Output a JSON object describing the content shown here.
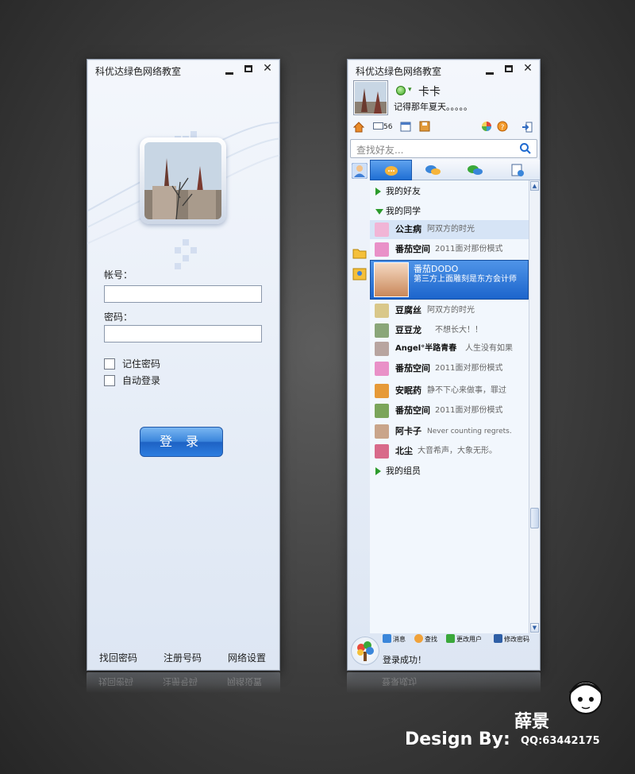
{
  "login_window": {
    "title": "科优达绿色网络教室",
    "account_label": "帐号：",
    "password_label": "密码：",
    "account_value": "",
    "password_value": "",
    "remember_label": "记住密码",
    "autologin_label": "自动登录",
    "login_button": "登 录",
    "footer": {
      "recover": "找回密码",
      "register": "注册号码",
      "network": "网络设置"
    }
  },
  "main_window": {
    "title": "科优达绿色网络教室",
    "nickname": "卡卡",
    "signature": "记得那年夏天。。。。。",
    "mail_count": "56",
    "search_placeholder": "查找好友...",
    "groups": [
      {
        "label": "我的好友",
        "expanded": false
      },
      {
        "label": "我的同学",
        "expanded": true
      },
      {
        "label": "我的组员",
        "expanded": false
      }
    ],
    "contacts": [
      {
        "name": "公主病",
        "status": "阿双方的时光",
        "color": "#f1b5d6"
      },
      {
        "name": "番茄空间",
        "status": "2011面对那份模式",
        "color": "#e991c8"
      },
      {
        "name": "番茄DODO",
        "status": "第三方上面雕刻是东方会计师",
        "selected": true
      },
      {
        "name": "豆腐丝",
        "status": "阿双方的时光",
        "color": "#d9c88a"
      },
      {
        "name": "豆豆龙",
        "status": "不想长大！！",
        "color": "#8aa679"
      },
      {
        "name": "Angel°半路青春",
        "status": "人生没有如果",
        "color": "#b8a5a0"
      },
      {
        "name": "番茄空间",
        "status": "2011面对那份模式",
        "color": "#e991c8"
      },
      {
        "name": "安眠药",
        "status": "静不下心来做事，罪过",
        "color": "#e69a38"
      },
      {
        "name": "番茄空间",
        "status": "2011面对那份模式",
        "color": "#7ba55a"
      },
      {
        "name": "阿卡子",
        "status": "Never counting regrets.",
        "color": "#c9a58a"
      },
      {
        "name": "北尘",
        "status": "大音希声，大象无形。",
        "color": "#d86a8a"
      }
    ],
    "bottom": {
      "message": "消息",
      "find": "查找",
      "change_user": "更改用户",
      "change_password": "修改密码",
      "status_message": "登录成功！"
    }
  },
  "reflections": {
    "login": [
      "找回密码",
      "注册号码",
      "网络设置"
    ],
    "main": "登录成功"
  },
  "credit": {
    "design_by": "Design By:",
    "author": "薛景",
    "qq": "QQ:63442175"
  }
}
